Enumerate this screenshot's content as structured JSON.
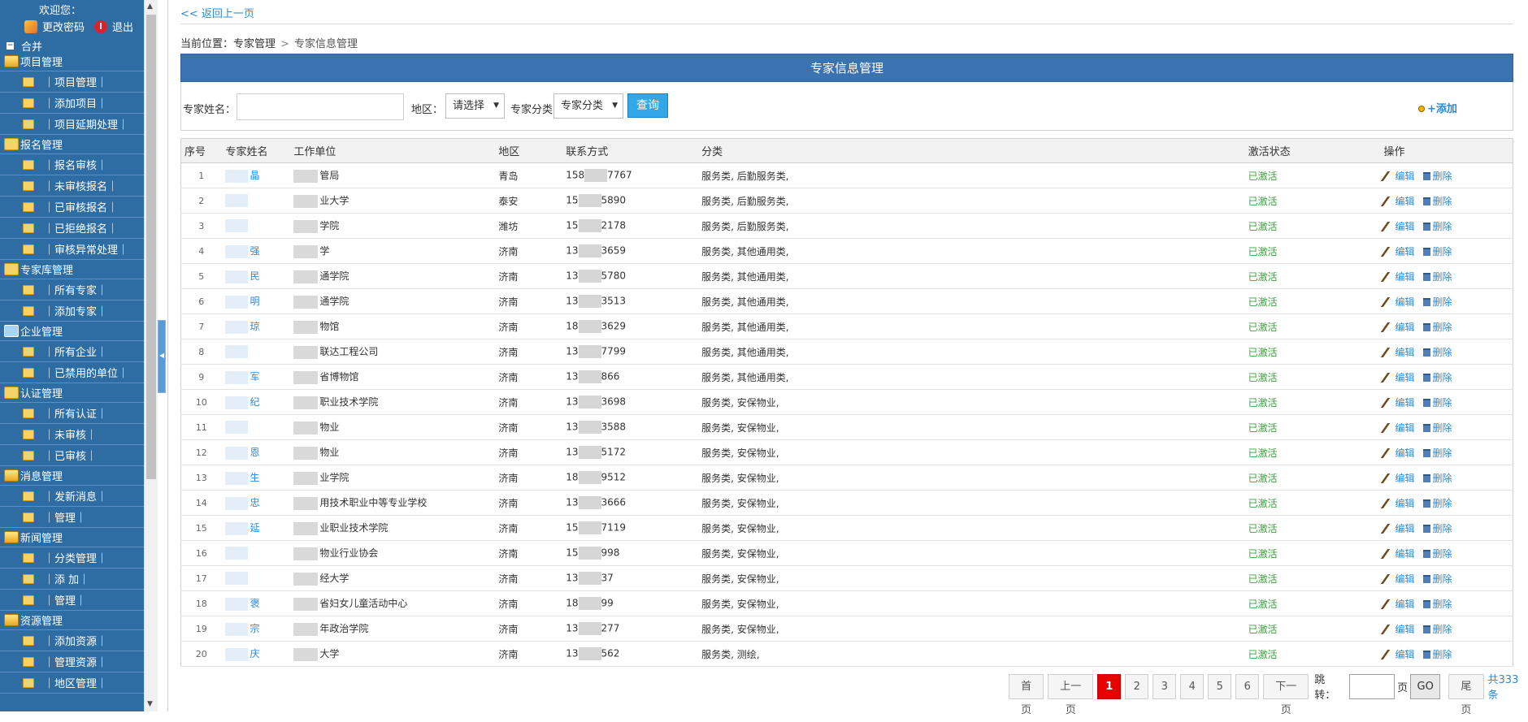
{
  "sidebar": {
    "welcome": "欢迎您：",
    "change_password": "更改密码",
    "logout": "退出",
    "merge": "合并",
    "groups": [
      {
        "title": "项目管理",
        "icon": "open-folder-icon",
        "items": [
          "｜项目管理｜",
          "｜添加项目｜",
          "｜项目延期处理｜"
        ]
      },
      {
        "title": "报名管理",
        "icon": "folder-icon",
        "items": [
          "｜报名审核｜",
          "｜未审核报名｜",
          "｜已审核报名｜",
          "｜已拒绝报名｜",
          "｜审核异常处理｜"
        ]
      },
      {
        "title": "专家库管理",
        "icon": "folder-icon",
        "items": [
          "｜所有专家｜",
          "｜添加专家｜"
        ]
      },
      {
        "title": "企业管理",
        "icon": "user-icon",
        "items": [
          "｜所有企业｜",
          "｜已禁用的单位｜"
        ]
      },
      {
        "title": "认证管理",
        "icon": "folder-icon",
        "items": [
          "｜所有认证｜",
          "｜未审核｜",
          "｜已审核｜"
        ]
      },
      {
        "title": "消息管理",
        "icon": "open-folder-icon",
        "items": [
          "｜发新消息｜",
          "｜管理｜"
        ]
      },
      {
        "title": "新闻管理",
        "icon": "open-folder-icon",
        "items": [
          "｜分类管理｜",
          "｜添 加｜",
          "｜管理｜"
        ]
      },
      {
        "title": "资源管理",
        "icon": "open-folder-icon",
        "items": [
          "｜添加资源｜",
          "｜管理资源｜",
          "｜地区管理｜"
        ]
      }
    ]
  },
  "main": {
    "back_link": "<< 返回上一页",
    "breadcrumb": {
      "label": "当前位置：",
      "level1": "专家管理",
      "sep": ">",
      "level2": "专家信息管理"
    },
    "panel_title": "专家信息管理",
    "search": {
      "name_label": "专家姓名：",
      "name_value": "",
      "region_label": "地区：",
      "region_selected": "请选择",
      "category_label": "专家分类",
      "category_selected": "专家分类",
      "query_button": "查询",
      "add_link": "+添加"
    },
    "table": {
      "headers": [
        "序号",
        "专家姓名",
        "工作单位",
        "地区",
        "联系方式",
        "分类",
        "激活状态",
        "操作"
      ],
      "edit_label": "编辑",
      "delete_label": "删除",
      "rows": [
        {
          "no": "1",
          "name": "晶",
          "unit": "管局",
          "region": "青岛",
          "phone_a": "158",
          "phone_b": "7767",
          "category": "服务类, 后勤服务类,",
          "status": "已激活"
        },
        {
          "no": "2",
          "name": "",
          "unit": "业大学",
          "region": "泰安",
          "phone_a": "15",
          "phone_b": "5890",
          "category": "服务类, 后勤服务类,",
          "status": "已激活"
        },
        {
          "no": "3",
          "name": "",
          "unit": "学院",
          "region": "潍坊",
          "phone_a": "15",
          "phone_b": "2178",
          "category": "服务类, 后勤服务类,",
          "status": "已激活"
        },
        {
          "no": "4",
          "name": "强",
          "unit": "学",
          "region": "济南",
          "phone_a": "13",
          "phone_b": "3659",
          "category": "服务类, 其他通用类,",
          "status": "已激活"
        },
        {
          "no": "5",
          "name": "民",
          "unit": "通学院",
          "region": "济南",
          "phone_a": "13",
          "phone_b": "5780",
          "category": "服务类, 其他通用类,",
          "status": "已激活"
        },
        {
          "no": "6",
          "name": "明",
          "unit": "通学院",
          "region": "济南",
          "phone_a": "13",
          "phone_b": "3513",
          "category": "服务类, 其他通用类,",
          "status": "已激活"
        },
        {
          "no": "7",
          "name": "琼",
          "unit": "物馆",
          "region": "济南",
          "phone_a": "18",
          "phone_b": "3629",
          "category": "服务类, 其他通用类,",
          "status": "已激活"
        },
        {
          "no": "8",
          "name": "",
          "unit": "联达工程公司",
          "region": "济南",
          "phone_a": "13",
          "phone_b": "7799",
          "category": "服务类, 其他通用类,",
          "status": "已激活"
        },
        {
          "no": "9",
          "name": "军",
          "unit": "省博物馆",
          "region": "济南",
          "phone_a": "13",
          "phone_b": "866",
          "category": "服务类, 其他通用类,",
          "status": "已激活"
        },
        {
          "no": "10",
          "name": "纪",
          "unit": "职业技术学院",
          "region": "济南",
          "phone_a": "13",
          "phone_b": "3698",
          "category": "服务类, 安保物业,",
          "status": "已激活"
        },
        {
          "no": "11",
          "name": "",
          "unit": "物业",
          "region": "济南",
          "phone_a": "13",
          "phone_b": "3588",
          "category": "服务类, 安保物业,",
          "status": "已激活"
        },
        {
          "no": "12",
          "name": "恩",
          "unit": "物业",
          "region": "济南",
          "phone_a": "13",
          "phone_b": "5172",
          "category": "服务类, 安保物业,",
          "status": "已激活"
        },
        {
          "no": "13",
          "name": "生",
          "unit": "业学院",
          "region": "济南",
          "phone_a": "18",
          "phone_b": "9512",
          "category": "服务类, 安保物业,",
          "status": "已激活"
        },
        {
          "no": "14",
          "name": "忠",
          "unit": "用技术职业中等专业学校",
          "region": "济南",
          "phone_a": "13",
          "phone_b": "3666",
          "category": "服务类, 安保物业,",
          "status": "已激活"
        },
        {
          "no": "15",
          "name": "延",
          "unit": "业职业技术学院",
          "region": "济南",
          "phone_a": "15",
          "phone_b": "7119",
          "category": "服务类, 安保物业,",
          "status": "已激活"
        },
        {
          "no": "16",
          "name": "",
          "unit": "物业行业协会",
          "region": "济南",
          "phone_a": "15",
          "phone_b": "998",
          "category": "服务类, 安保物业,",
          "status": "已激活"
        },
        {
          "no": "17",
          "name": "",
          "unit": "经大学",
          "region": "济南",
          "phone_a": "13",
          "phone_b": "37",
          "category": "服务类, 安保物业,",
          "status": "已激活"
        },
        {
          "no": "18",
          "name": "褒",
          "unit": "省妇女儿童活动中心",
          "region": "济南",
          "phone_a": "18",
          "phone_b": "99",
          "category": "服务类, 安保物业,",
          "status": "已激活"
        },
        {
          "no": "19",
          "name": "宗",
          "unit": "年政治学院",
          "region": "济南",
          "phone_a": "13",
          "phone_b": "277",
          "category": "服务类, 安保物业,",
          "status": "已激活"
        },
        {
          "no": "20",
          "name": "庆",
          "unit": "大学",
          "region": "济南",
          "phone_a": "13",
          "phone_b": "562",
          "category": "服务类, 测绘,",
          "status": "已激活"
        }
      ]
    },
    "pager": {
      "first": "首页",
      "prev": "上一页",
      "pages": [
        "1",
        "2",
        "3",
        "4",
        "5",
        "6"
      ],
      "active_page": "1",
      "next": "下一页",
      "jump_label": "跳转：",
      "jump_value": "",
      "page_unit": "页",
      "go": "GO",
      "last": "尾页",
      "total": "共333条"
    }
  }
}
